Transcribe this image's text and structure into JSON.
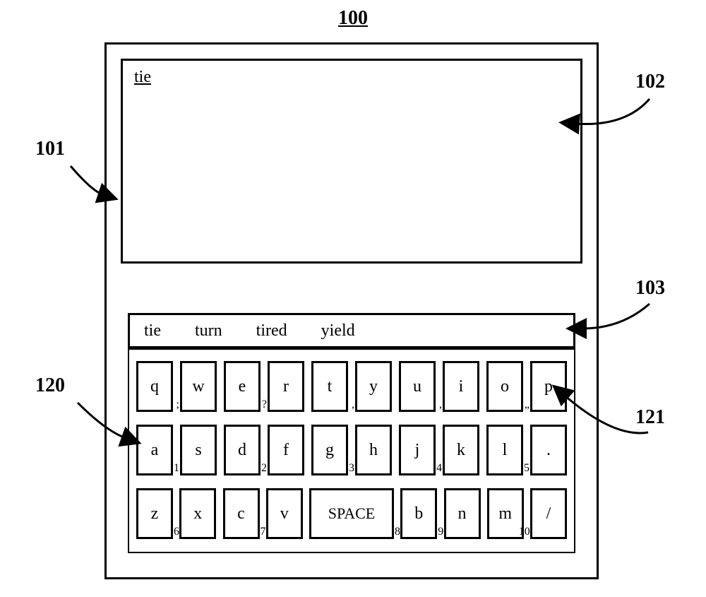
{
  "figure_label": "100",
  "typed_text": "tie",
  "suggestions": [
    "tie",
    "turn",
    "tired",
    "yield"
  ],
  "keyboard": {
    "row1": [
      {
        "main": "q",
        "sec": ";"
      },
      {
        "main": "w",
        "sec": ""
      },
      {
        "main": "e",
        "sec": "?"
      },
      {
        "main": "r",
        "sec": ""
      },
      {
        "main": "t",
        "sec": ","
      },
      {
        "main": "y",
        "sec": ""
      },
      {
        "main": "u",
        "sec": ","
      },
      {
        "main": "i",
        "sec": ""
      },
      {
        "main": "o",
        "sec": "„"
      },
      {
        "main": "p",
        "sec": ""
      }
    ],
    "row2": [
      {
        "main": "a",
        "sec": "1"
      },
      {
        "main": "s",
        "sec": ""
      },
      {
        "main": "d",
        "sec": "2"
      },
      {
        "main": "f",
        "sec": ""
      },
      {
        "main": "g",
        "sec": "3"
      },
      {
        "main": "h",
        "sec": ""
      },
      {
        "main": "j",
        "sec": "4"
      },
      {
        "main": "k",
        "sec": ""
      },
      {
        "main": "l",
        "sec": "5"
      },
      {
        "main": ".",
        "sec": ""
      }
    ],
    "row3": [
      {
        "main": "z",
        "sec": "6"
      },
      {
        "main": "x",
        "sec": ""
      },
      {
        "main": "c",
        "sec": "7"
      },
      {
        "main": "v",
        "sec": ""
      },
      {
        "main": "SPACE",
        "sec": "8",
        "wide": true
      },
      {
        "main": "b",
        "sec": "9"
      },
      {
        "main": "n",
        "sec": ""
      },
      {
        "main": "m",
        "sec": "10"
      },
      {
        "main": "/",
        "sec": ""
      }
    ]
  },
  "callouts": {
    "c101": "101",
    "c102": "102",
    "c103": "103",
    "c120": "120",
    "c121": "121"
  }
}
